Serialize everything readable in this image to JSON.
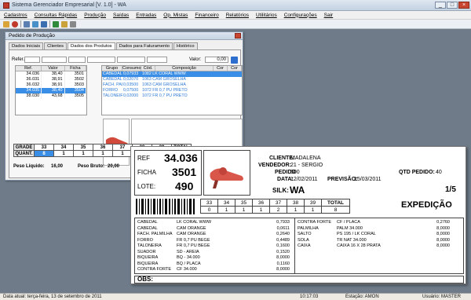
{
  "window": {
    "title": "Sistema Gerenciador Empresarial [V. 1.0] - WA"
  },
  "menu": [
    "Cadastros",
    "Consultas Rápidas",
    "Produção",
    "Saídas",
    "Entradas",
    "Op. Mistas",
    "Financeiro",
    "Relatórios",
    "Utilitários",
    "Configurações",
    "Sair"
  ],
  "dialog": {
    "title": "Pedido de Produção",
    "tabs": [
      "Dados Iniciais",
      "Clientes",
      "Dados dos Produtos",
      "Dados para Faturamento",
      "Histórico"
    ],
    "ref_label": "Refer.",
    "valor_label": "Valor:",
    "valor_value": "0,00",
    "grid1": {
      "headers": [
        "Ref.",
        "Valor",
        "Ficha"
      ],
      "rows": [
        [
          "34.036",
          "38,40",
          "3501"
        ],
        [
          "36.031",
          "38,91",
          "3502"
        ],
        [
          "36.032",
          "38,91",
          "3503"
        ],
        [
          "34.035",
          "38,40",
          "3504"
        ],
        [
          "38.030",
          "43,68",
          "3505"
        ]
      ]
    },
    "grid2": {
      "headers": [
        "Grupo",
        "Consumo",
        "Cód.",
        "Composição",
        "Cor",
        "Cor"
      ],
      "rows": [
        [
          "CABEDAL",
          "0,07933",
          "1082 LK CORAL WWW"
        ],
        [
          "CABEDAL",
          "0,02070",
          "1063 CAM GROSELHA"
        ],
        [
          "FACH. PALI",
          "0,03500",
          "1063 CAM GROSELHA"
        ],
        [
          "FORRO",
          "0,07500",
          "1072 FR 0,7 PU PRETO"
        ],
        [
          "TALONEIRA",
          "0,02000",
          "1072 FR 0,7 PU PRETO"
        ]
      ]
    },
    "grade": {
      "label": "GRADE",
      "sizes": [
        "33",
        "34",
        "35",
        "36",
        "37",
        "38",
        "39"
      ],
      "total_label": "TOTAL",
      "quant_label": "QUANT.",
      "quants": [
        "8",
        "1",
        "1",
        "1",
        "1",
        "",
        "",
        ""
      ]
    },
    "peso_liquido_label": "Peso Líquido:",
    "peso_liquido": "16,00",
    "peso_bruto_label": "Peso Bruto:",
    "peso_bruto": "20,00"
  },
  "report": {
    "ref_label": "REF",
    "ref": "34.036",
    "ficha_label": "FICHA",
    "ficha": "3501",
    "lote_label": "LOTE:",
    "lote": "490",
    "cliente_label": "CLIENTE:",
    "cliente": "MADALENA",
    "vendedor_label": "VENDEDOR:",
    "vendedor": "21 - SERGIO",
    "pedido_label": "PEDIDO",
    "pedido": "500",
    "qtd_label": "QTD PEDIDO:",
    "qtd": "40",
    "data_label": "DATA:",
    "data": "12/02/2011",
    "previsao_label": "PREVISÃO:",
    "previsao": "15/03/2011",
    "silk_label": "SILK:",
    "silk": "WA",
    "pages": "1/5",
    "sizes": [
      "33",
      "34",
      "35",
      "36",
      "37",
      "38",
      "39"
    ],
    "quants": [
      "0",
      "1",
      "1",
      "1",
      "2",
      "1",
      "1"
    ],
    "total_label": "TOTAL",
    "total": "8",
    "expedicao": "EXPEDIÇÃO",
    "left_lines": [
      [
        "CABEDAL",
        "LK CORAL WWW",
        "0,7933"
      ],
      [
        "CABEDAL",
        "CAM ORANGE",
        "0,0611"
      ],
      [
        "FACH. PALMILHA",
        "CAM ORANGE",
        "0,2640"
      ],
      [
        "FORRO",
        "FR 0,7 PU BEGE",
        "0,4489"
      ],
      [
        "TALONEIRA",
        "FR 0,7 PU BEGE",
        "0,1600"
      ],
      [
        "SUADOR",
        "SD - AREIA",
        "0,1520"
      ],
      [
        "BIQUEIRA",
        "BQ - 34.000",
        "8,0000"
      ],
      [
        "BIQUEIRA",
        "BQ / PLACA",
        "0,1160"
      ],
      [
        "CONTRA FORTE",
        "CF 34.000",
        "8,0000"
      ]
    ],
    "right_lines": [
      [
        "CONTRA FORTE",
        "CF / PLACA",
        "0,2760"
      ],
      [
        "PALMILHA",
        "PALM 34.000",
        "8,0000"
      ],
      [
        "SALTO",
        "PS 195 / LK CORAL",
        "8,0000"
      ],
      [
        "SOLA",
        "TR NAT 34.000",
        "8,0000"
      ],
      [
        "CAIXA",
        "CAIXA 16 X 28 PRATA",
        "8,0000"
      ]
    ],
    "obs_label": "OBS:"
  },
  "status": {
    "date": "Data atual: terça-feira, 13 de setembro de 2011",
    "time": "10:17:03",
    "station": "Estação: AMON",
    "user": "Usuário: MASTER"
  }
}
